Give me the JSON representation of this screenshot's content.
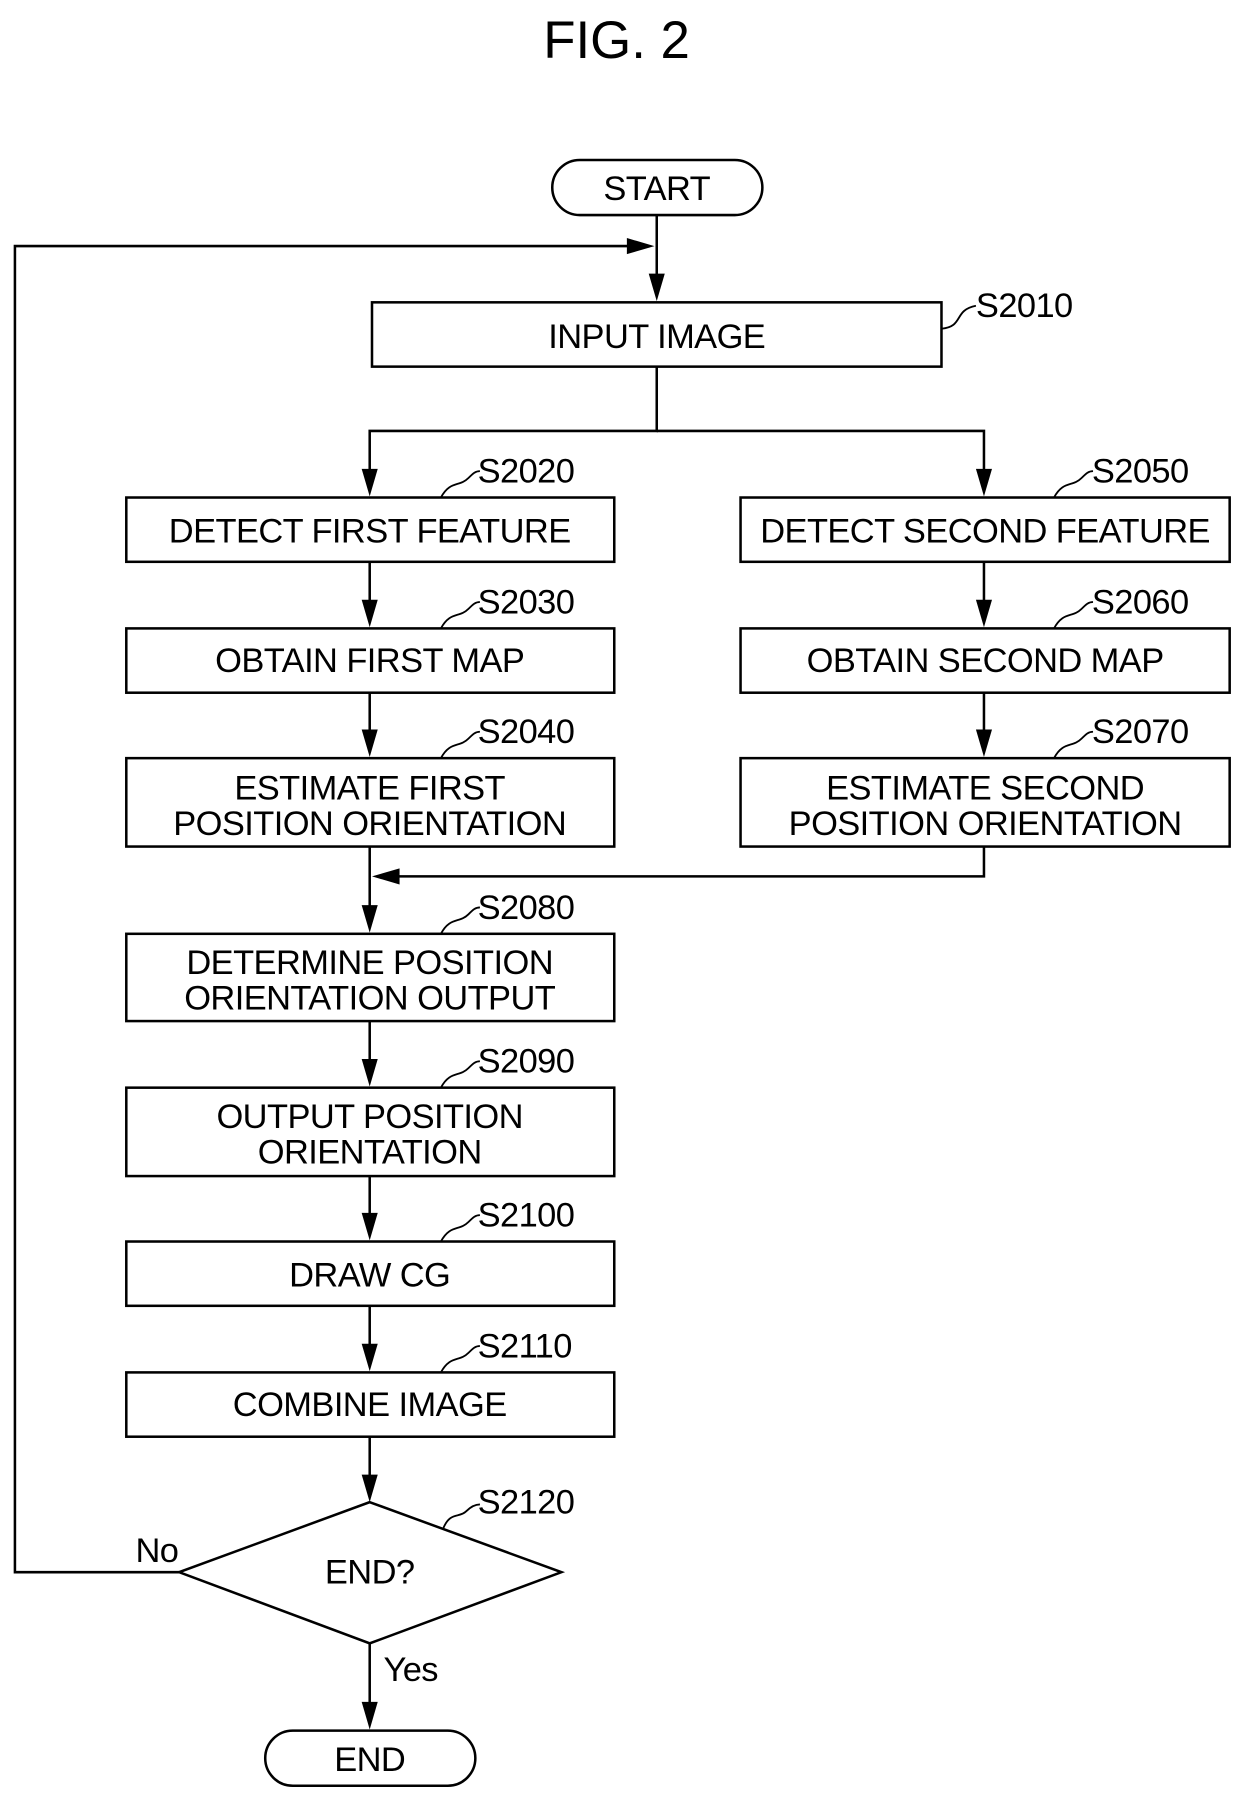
{
  "figure": {
    "title": "FIG. 2"
  },
  "terminals": {
    "start": "START",
    "end": "END"
  },
  "steps": {
    "s2010": {
      "id": "S2010",
      "lines": [
        "INPUT IMAGE"
      ]
    },
    "s2020": {
      "id": "S2020",
      "lines": [
        "DETECT FIRST FEATURE"
      ]
    },
    "s2030": {
      "id": "S2030",
      "lines": [
        "OBTAIN FIRST MAP"
      ]
    },
    "s2040": {
      "id": "S2040",
      "lines": [
        "ESTIMATE FIRST",
        "POSITION ORIENTATION"
      ]
    },
    "s2050": {
      "id": "S2050",
      "lines": [
        "DETECT SECOND FEATURE"
      ]
    },
    "s2060": {
      "id": "S2060",
      "lines": [
        "OBTAIN SECOND MAP"
      ]
    },
    "s2070": {
      "id": "S2070",
      "lines": [
        "ESTIMATE SECOND",
        "POSITION ORIENTATION"
      ]
    },
    "s2080": {
      "id": "S2080",
      "lines": [
        "DETERMINE POSITION",
        "ORIENTATION OUTPUT"
      ]
    },
    "s2090": {
      "id": "S2090",
      "lines": [
        "OUTPUT POSITION",
        "ORIENTATION"
      ]
    },
    "s2100": {
      "id": "S2100",
      "lines": [
        "DRAW CG"
      ]
    },
    "s2110": {
      "id": "S2110",
      "lines": [
        "COMBINE IMAGE"
      ]
    }
  },
  "decision": {
    "id": "S2120",
    "question": "END?",
    "no_label": "No",
    "yes_label": "Yes"
  }
}
